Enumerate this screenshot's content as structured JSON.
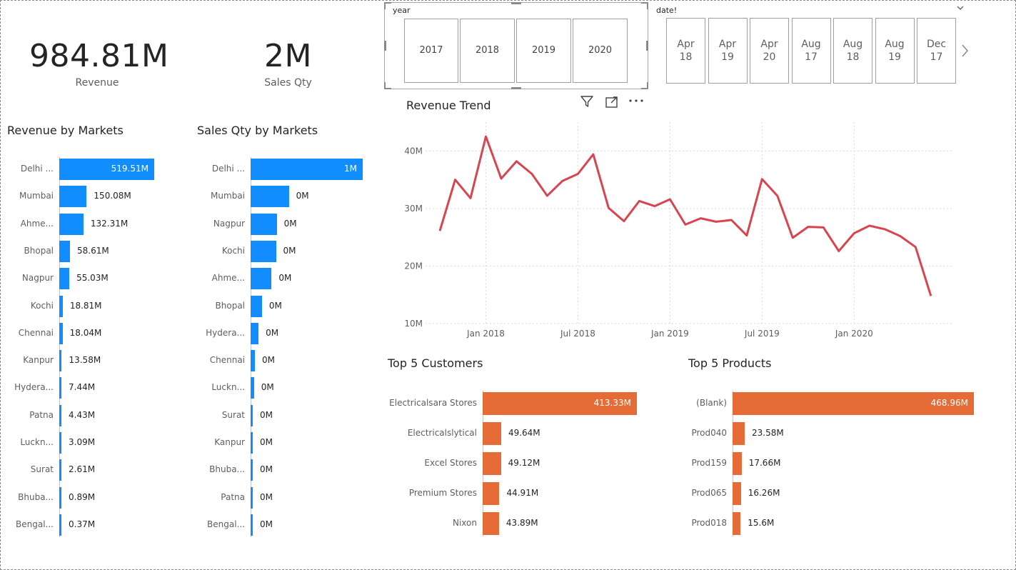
{
  "kpis": {
    "revenue": {
      "value": "984.81M",
      "label": "Revenue"
    },
    "sales_qty": {
      "value": "2M",
      "label": "Sales Qty"
    }
  },
  "slicers": {
    "year": {
      "header": "year",
      "options": [
        "2017",
        "2018",
        "2019",
        "2020"
      ]
    },
    "date": {
      "header": "date!",
      "options": [
        {
          "m": "Apr",
          "d": "18"
        },
        {
          "m": "Apr",
          "d": "19"
        },
        {
          "m": "Apr",
          "d": "20"
        },
        {
          "m": "Aug",
          "d": "17"
        },
        {
          "m": "Aug",
          "d": "18"
        },
        {
          "m": "Aug",
          "d": "19"
        },
        {
          "m": "Dec",
          "d": "17"
        }
      ]
    }
  },
  "icons": [
    "filter-icon",
    "focus-mode-icon",
    "more-options-icon",
    "chevron-right-icon",
    "chevron-down-icon"
  ],
  "colors": {
    "blue": "#118dff",
    "orange": "#e66c37",
    "line": "#d64550"
  },
  "chart_data": [
    {
      "type": "bar",
      "title": "Revenue by Markets",
      "categories": [
        "Delhi ...",
        "Mumbai",
        "Ahme...",
        "Bhopal",
        "Nagpur",
        "Kochi",
        "Chennai",
        "Kanpur",
        "Hydera...",
        "Patna",
        "Luckn...",
        "Surat",
        "Bhuba...",
        "Bengal..."
      ],
      "values": [
        519.51,
        150.08,
        132.31,
        58.61,
        55.03,
        18.81,
        18.04,
        13.58,
        7.44,
        4.43,
        3.09,
        2.61,
        0.89,
        0.37
      ],
      "labels": [
        "519.51M",
        "150.08M",
        "132.31M",
        "58.61M",
        "55.03M",
        "18.81M",
        "18.04M",
        "13.58M",
        "7.44M",
        "4.43M",
        "3.09M",
        "2.61M",
        "0.89M",
        "0.37M"
      ],
      "orientation": "horizontal",
      "color": "#118dff"
    },
    {
      "type": "bar",
      "title": "Sales Qty by Markets",
      "categories": [
        "Delhi ...",
        "Mumbai",
        "Nagpur",
        "Kochi",
        "Ahme...",
        "Bhopal",
        "Hydera...",
        "Chennai",
        "Luckn...",
        "Surat",
        "Kanpur",
        "Bhuba...",
        "Patna",
        "Bengal..."
      ],
      "values": [
        989000,
        338000,
        231000,
        224000,
        185000,
        100000,
        70000,
        38000,
        30000,
        10000,
        9000,
        8000,
        7000,
        3000
      ],
      "labels": [
        "1M",
        "0M",
        "0M",
        "0M",
        "0M",
        "0M",
        "0M",
        "0M",
        "0M",
        "0M",
        "0M",
        "0M",
        "0M",
        "0M"
      ],
      "orientation": "horizontal",
      "color": "#118dff"
    },
    {
      "type": "line",
      "title": "Revenue Trend",
      "x": [
        "2017-10",
        "2017-11",
        "2017-12",
        "2018-01",
        "2018-02",
        "2018-03",
        "2018-04",
        "2018-05",
        "2018-06",
        "2018-07",
        "2018-08",
        "2018-09",
        "2018-10",
        "2018-11",
        "2018-12",
        "2019-01",
        "2019-02",
        "2019-03",
        "2019-04",
        "2019-05",
        "2019-06",
        "2019-07",
        "2019-08",
        "2019-09",
        "2019-10",
        "2019-11",
        "2019-12",
        "2020-01",
        "2020-02",
        "2020-03",
        "2020-04",
        "2020-05",
        "2020-06"
      ],
      "y": [
        26.1,
        35.0,
        31.8,
        42.5,
        35.2,
        38.2,
        36.0,
        32.2,
        34.8,
        36.0,
        39.4,
        30.1,
        27.8,
        31.3,
        30.4,
        31.6,
        27.2,
        28.3,
        27.7,
        28.0,
        25.3,
        35.1,
        32.2,
        24.9,
        26.8,
        26.7,
        22.6,
        25.7,
        27.0,
        26.4,
        25.2,
        23.3,
        14.8
      ],
      "xticks": [
        "Jan 2018",
        "Jul 2018",
        "Jan 2019",
        "Jul 2019",
        "Jan 2020"
      ],
      "yticks": [
        "10M",
        "20M",
        "30M",
        "40M"
      ],
      "ylim": [
        10,
        45
      ],
      "grid": true,
      "color": "#d64550"
    },
    {
      "type": "bar",
      "title": "Top 5 Customers",
      "categories": [
        "Electricalsara Stores",
        "Electricalslytical",
        "Excel Stores",
        "Premium Stores",
        "Nixon"
      ],
      "values": [
        413.33,
        49.64,
        49.12,
        44.91,
        43.89
      ],
      "labels": [
        "413.33M",
        "49.64M",
        "49.12M",
        "44.91M",
        "43.89M"
      ],
      "orientation": "horizontal",
      "color": "#e66c37"
    },
    {
      "type": "bar",
      "title": "Top 5 Products",
      "categories": [
        "(Blank)",
        "Prod040",
        "Prod159",
        "Prod065",
        "Prod018"
      ],
      "values": [
        468.96,
        23.58,
        17.66,
        16.26,
        15.6
      ],
      "labels": [
        "468.96M",
        "23.58M",
        "17.66M",
        "16.26M",
        "15.6M"
      ],
      "orientation": "horizontal",
      "color": "#e66c37"
    }
  ]
}
